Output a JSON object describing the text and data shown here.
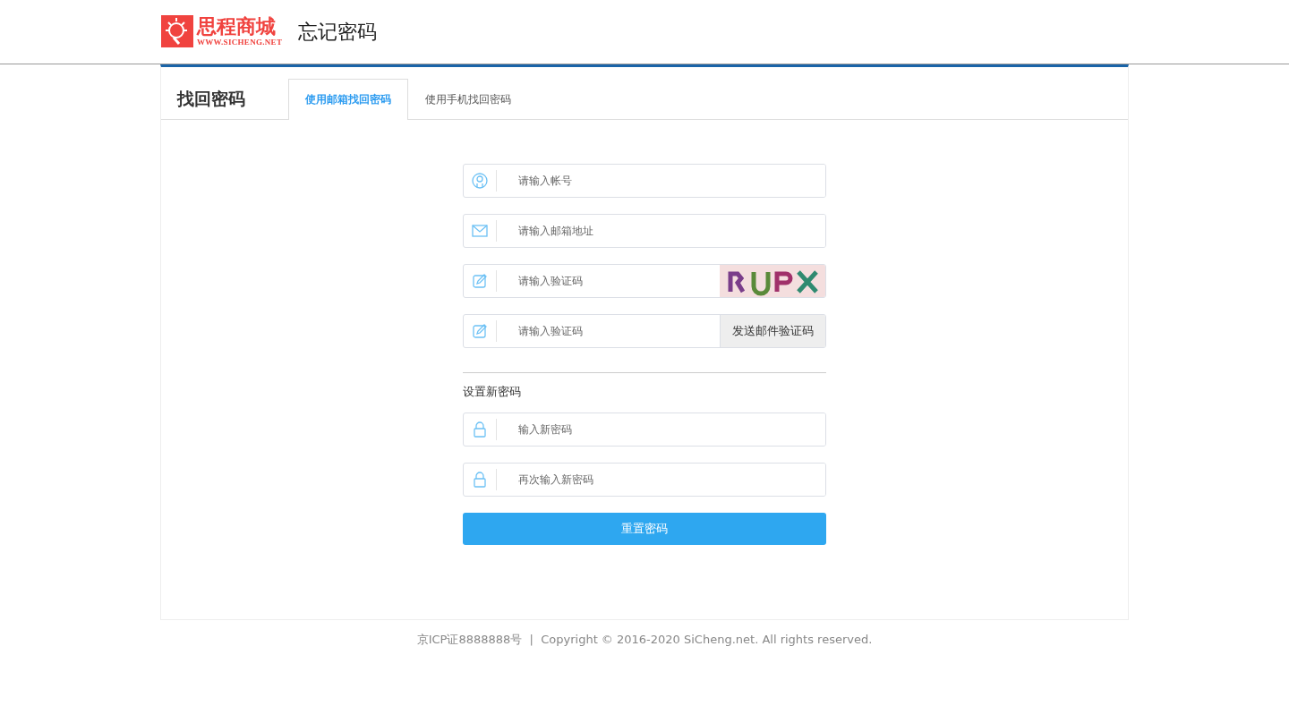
{
  "header": {
    "logo_text": "思程商城",
    "logo_url": "WWW.SICHENG.NET",
    "title": "忘记密码"
  },
  "panel": {
    "title": "找回密码",
    "tabs": [
      {
        "label": "使用邮箱找回密码",
        "selected": true
      },
      {
        "label": "使用手机找回密码",
        "selected": false
      }
    ]
  },
  "fields": [
    {
      "kind": "account",
      "placeholder": "请输入帐号"
    },
    {
      "kind": "email",
      "placeholder": "请输入邮箱地址"
    },
    {
      "kind": "captcha",
      "placeholder": "请输入验证码"
    },
    {
      "kind": "send",
      "placeholder": "请输入验证码",
      "button": "发送邮件验证码"
    }
  ],
  "new_password": {
    "label": "设置新密码",
    "fields": [
      {
        "placeholder": "输入新密码"
      },
      {
        "placeholder": "再次输入新密码"
      }
    ]
  },
  "submit": "重置密码",
  "footer": "京ICP证8888888号  |  Copyright © 2016-2020 SiCheng.net. All rights reserved."
}
